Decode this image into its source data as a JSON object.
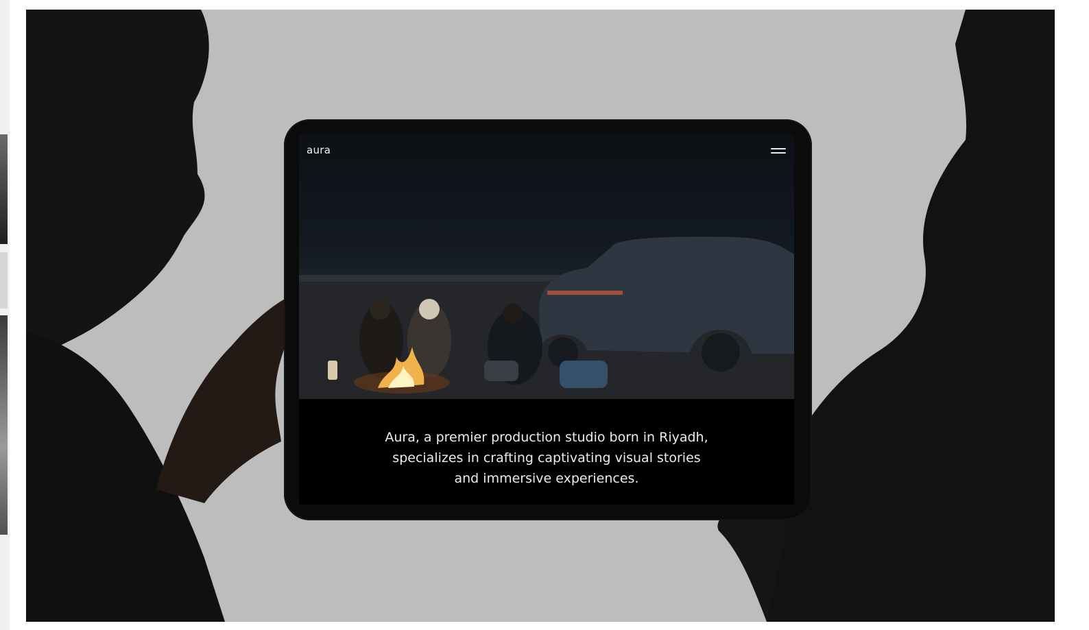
{
  "site": {
    "logo_text": "aura",
    "tagline_lines": [
      "Aura, a premier production studio born in Riyadh,",
      "specializes in crafting captivating visual stories",
      "and immersive experiences."
    ]
  },
  "icons": {
    "menu": "hamburger-menu-icon"
  },
  "colors": {
    "background": "#bdbdbd",
    "device": "#0b0b0b",
    "screen_text": "#ececec"
  }
}
